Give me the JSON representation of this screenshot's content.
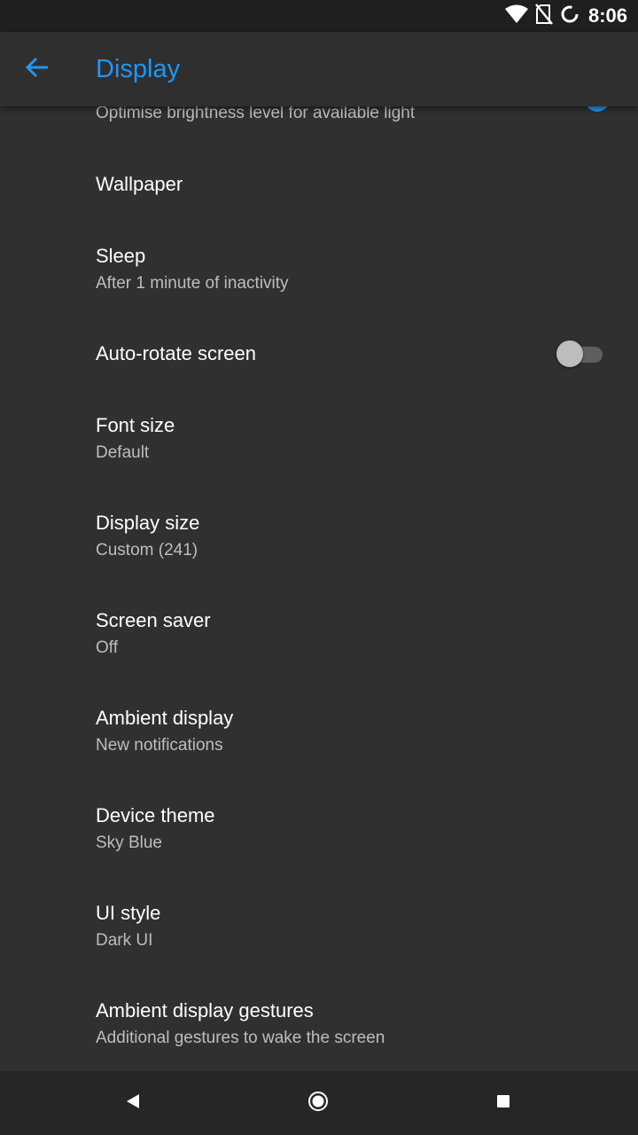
{
  "status_bar": {
    "time": "8:06",
    "icons": [
      "wifi-icon",
      "no-sim-icon",
      "battery-charging-icon"
    ]
  },
  "app_bar": {
    "title": "Display",
    "back_icon": "arrow-back-icon",
    "accent_color": "#2196f3"
  },
  "settings": {
    "adaptive_brightness": {
      "summary": "Optimise brightness level for available light",
      "enabled": true
    },
    "wallpaper": {
      "title": "Wallpaper"
    },
    "sleep": {
      "title": "Sleep",
      "summary": "After 1 minute of inactivity"
    },
    "auto_rotate": {
      "title": "Auto-rotate screen",
      "enabled": false
    },
    "font_size": {
      "title": "Font size",
      "summary": "Default"
    },
    "display_size": {
      "title": "Display size",
      "summary": "Custom (241)"
    },
    "screen_saver": {
      "title": "Screen saver",
      "summary": "Off"
    },
    "ambient_display": {
      "title": "Ambient display",
      "summary": "New notifications"
    },
    "device_theme": {
      "title": "Device theme",
      "summary": "Sky Blue"
    },
    "ui_style": {
      "title": "UI style",
      "summary": "Dark UI"
    },
    "ambient_gestures": {
      "title": "Ambient display gestures",
      "summary": "Additional gestures to wake the screen"
    }
  },
  "nav_bar": {
    "icons": [
      "back-triangle-icon",
      "home-circle-icon",
      "recents-square-icon"
    ]
  }
}
